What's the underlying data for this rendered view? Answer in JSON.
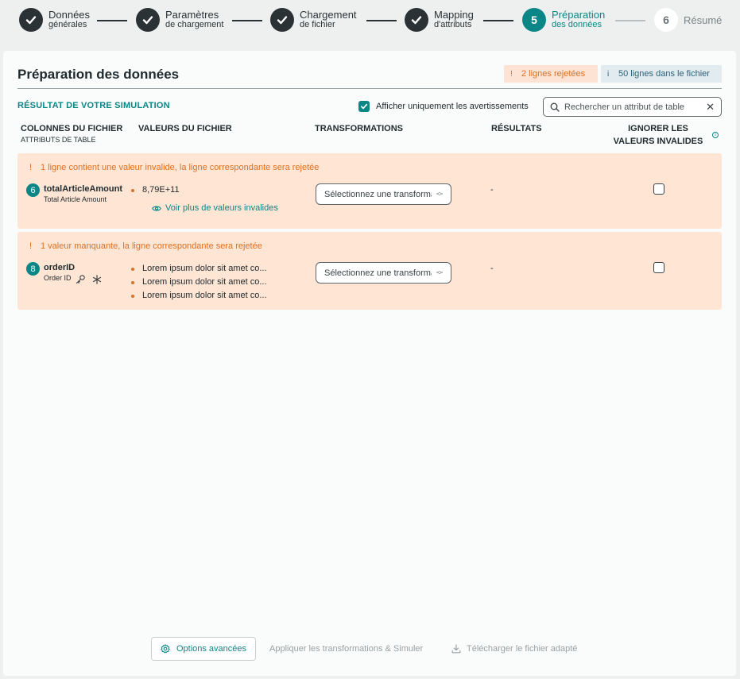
{
  "stepper": {
    "steps": [
      {
        "title": "Données",
        "subtitle": "générales",
        "state": "done"
      },
      {
        "title": "Paramètres",
        "subtitle": "de chargement",
        "state": "done"
      },
      {
        "title": "Chargement",
        "subtitle": "de fichier",
        "state": "done"
      },
      {
        "title": "Mapping",
        "subtitle": "d'attributs",
        "state": "done"
      },
      {
        "number": "5",
        "title": "Préparation",
        "subtitle": "des données",
        "state": "active"
      },
      {
        "number": "6",
        "title": "Résumé",
        "subtitle": "",
        "state": "todo"
      }
    ]
  },
  "header": {
    "title": "Préparation des données",
    "rejected_badge": "2 lignes rejetées",
    "rejected_icon": "!",
    "info_badge": "50 lignes dans le fichier",
    "info_icon": "i"
  },
  "toolbar": {
    "subtitle": "RÉSULTAT DE VOTRE SIMULATION",
    "warnings_only_label": "Afficher uniquement les avertissements",
    "warnings_only_checked": true,
    "search_placeholder": "Rechercher un attribut de table"
  },
  "columns": {
    "file_columns": "COLONNES DU FICHIER",
    "table_attributes": "ATTRIBUTS DE TABLE",
    "file_values": "VALEURS DU FICHIER",
    "transformations": "TRANSFORMATIONS",
    "results": "RÉSULTATS",
    "ignore_line1": "IGNORER LES",
    "ignore_line2": "VALEURS INVALIDES"
  },
  "rows": [
    {
      "warning": "1 ligne contient une valeur invalide, la ligne correspondante sera rejetée",
      "index": "6",
      "attr_name": "totalArticleAmount",
      "attr_label": "Total Article Amount",
      "values": [
        "8,79E+11"
      ],
      "more_link": "Voir plus de valeurs invalides",
      "transformation_placeholder": "Sélectionnez une transformation",
      "result": "-",
      "ignore_checked": false
    },
    {
      "warning": "1 valeur manquante, la ligne correspondante sera rejetée",
      "index": "8",
      "attr_name": "orderID",
      "attr_label": "Order ID",
      "values": [
        "Lorem ipsum dolor sit amet co...",
        "Lorem ipsum dolor sit amet co...",
        "Lorem ipsum dolor sit amet co..."
      ],
      "transformation_placeholder": "Sélectionnez une transformation",
      "result": "-",
      "ignore_checked": false
    }
  ],
  "footer": {
    "advanced_options": "Options avancées",
    "apply_simulate": "Appliquer les transformations & Simuler",
    "download": "Télécharger le fichier adapté"
  },
  "colors": {
    "accent": "#0b8686",
    "warning": "#e0701f",
    "warning_bg": "#fee5d4",
    "dark": "#2b3236"
  }
}
